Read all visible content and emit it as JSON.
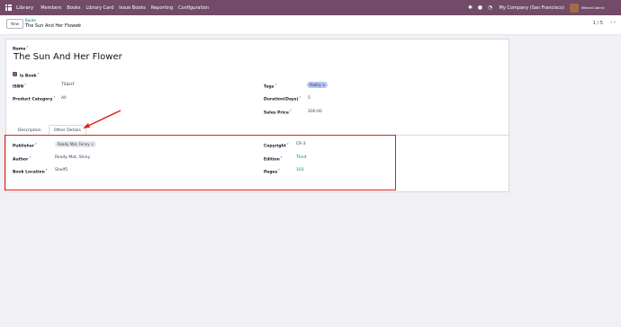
{
  "navbar": {
    "app_name": "Library",
    "menu": [
      "Members",
      "Books",
      "Library Card",
      "Issue Books",
      "Reporting",
      "Configuration"
    ],
    "company": "My Company (San Francisco)",
    "user": "Mitchell Admin"
  },
  "control": {
    "new_label": "New",
    "breadcrumb_parent": "Books",
    "breadcrumb_title": "The Sun And Her Flower",
    "pager": "1 / 5"
  },
  "form": {
    "name_label": "Name",
    "name_value": "The Sun And Her Flower",
    "is_book_label": "Is Book",
    "isbn_label": "ISBN",
    "isbn_value": "TS&HF",
    "product_category_label": "Product Category",
    "product_category_value": "All",
    "tags_label": "Tags",
    "tags_value": "Poetry",
    "duration_label": "Duration(Days)",
    "duration_value": "5",
    "sales_price_label": "Sales Price",
    "sales_price_value": "200.00"
  },
  "tabs": [
    "Description",
    "Other Details"
  ],
  "other_details": {
    "publisher_label": "Publisher",
    "publisher_value": "Ready Mat, Fenny",
    "author_label": "Author",
    "author_value": "Ready Mat, Shiny",
    "book_location_label": "Book Location",
    "book_location_value": "Shelf5",
    "copyright_label": "Copyright",
    "copyright_value": "CR-3",
    "edition_label": "Edition",
    "edition_value": "Third",
    "pages_label": "Pages",
    "pages_value": "103"
  },
  "colors": {
    "navbar": "#714b67",
    "annotation": "#e02020",
    "tag": "#b9c6f5"
  }
}
